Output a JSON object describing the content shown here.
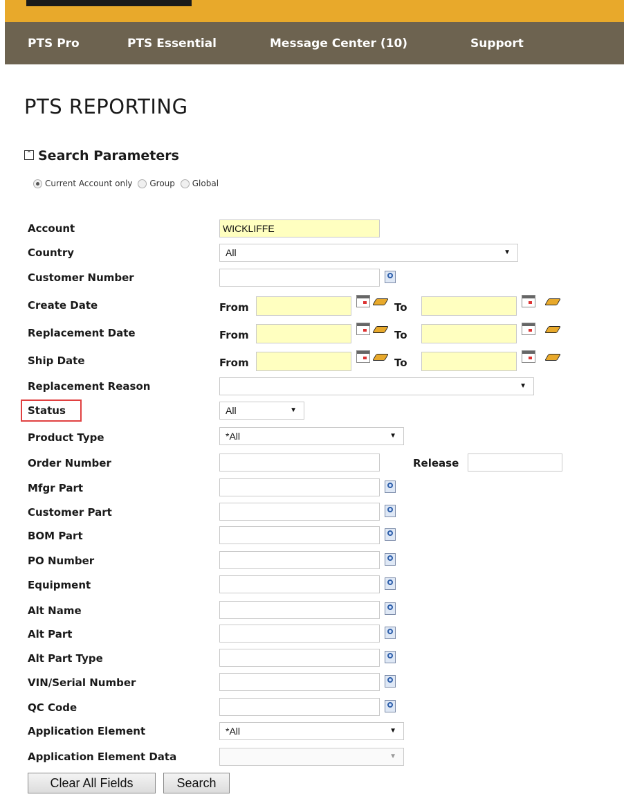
{
  "nav": {
    "items": [
      "PTS Pro",
      "PTS Essential",
      "Message Center (10)",
      "Support"
    ]
  },
  "page": {
    "title": "PTS REPORTING",
    "section_title": "Search Parameters"
  },
  "scope": {
    "options": [
      "Current Account only",
      "Group",
      "Global"
    ],
    "selected": "Current Account only"
  },
  "form": {
    "account": {
      "label": "Account",
      "value": "WICKLIFFE"
    },
    "country": {
      "label": "Country",
      "value": "All"
    },
    "customer_number": {
      "label": "Customer Number",
      "value": ""
    },
    "create_date": {
      "label": "Create Date",
      "from_label": "From",
      "to_label": "To"
    },
    "replacement_date": {
      "label": "Replacement Date",
      "from_label": "From",
      "to_label": "To"
    },
    "ship_date": {
      "label": "Ship Date",
      "from_label": "From",
      "to_label": "To"
    },
    "replacement_reason": {
      "label": "Replacement Reason",
      "value": ""
    },
    "status": {
      "label": "Status",
      "value": "All"
    },
    "product_type": {
      "label": "Product Type",
      "value": "*All"
    },
    "order_number": {
      "label": "Order Number",
      "value": "",
      "release_label": "Release"
    },
    "mfgr_part": {
      "label": "Mfgr Part"
    },
    "customer_part": {
      "label": "Customer Part"
    },
    "bom_part": {
      "label": "BOM Part"
    },
    "po_number": {
      "label": "PO Number"
    },
    "equipment": {
      "label": "Equipment"
    },
    "alt_name": {
      "label": "Alt Name"
    },
    "alt_part": {
      "label": "Alt Part"
    },
    "alt_part_type": {
      "label": "Alt Part Type"
    },
    "vin_serial": {
      "label": "VIN/Serial Number"
    },
    "qc_code": {
      "label": "QC Code"
    },
    "application_element": {
      "label": "Application Element",
      "value": "*All"
    },
    "application_element_data": {
      "label": "Application Element Data",
      "value": ""
    }
  },
  "buttons": {
    "clear": "Clear All Fields",
    "search": "Search"
  },
  "colors": {
    "top_strip": "#e8a92b",
    "nav_bar": "#6d6350",
    "input_highlight": "#ffffc0",
    "status_highlight_border": "#e04040"
  }
}
